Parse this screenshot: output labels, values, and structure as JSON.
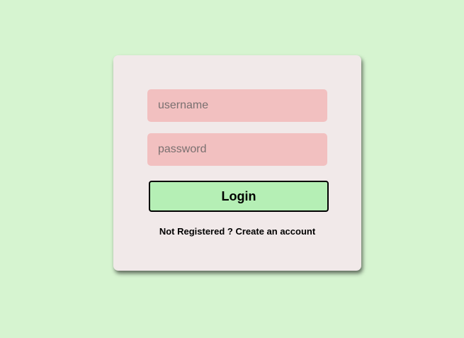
{
  "login_form": {
    "username": {
      "placeholder": "username",
      "value": ""
    },
    "password": {
      "placeholder": "password",
      "value": ""
    },
    "login_label": "Login",
    "register_prompt": "Not Registered ?",
    "register_link": "Create an account"
  },
  "colors": {
    "background": "#d6f4d0",
    "card": "#f1e9e9",
    "input": "#f2c0c0",
    "button": "#b5efb5"
  }
}
